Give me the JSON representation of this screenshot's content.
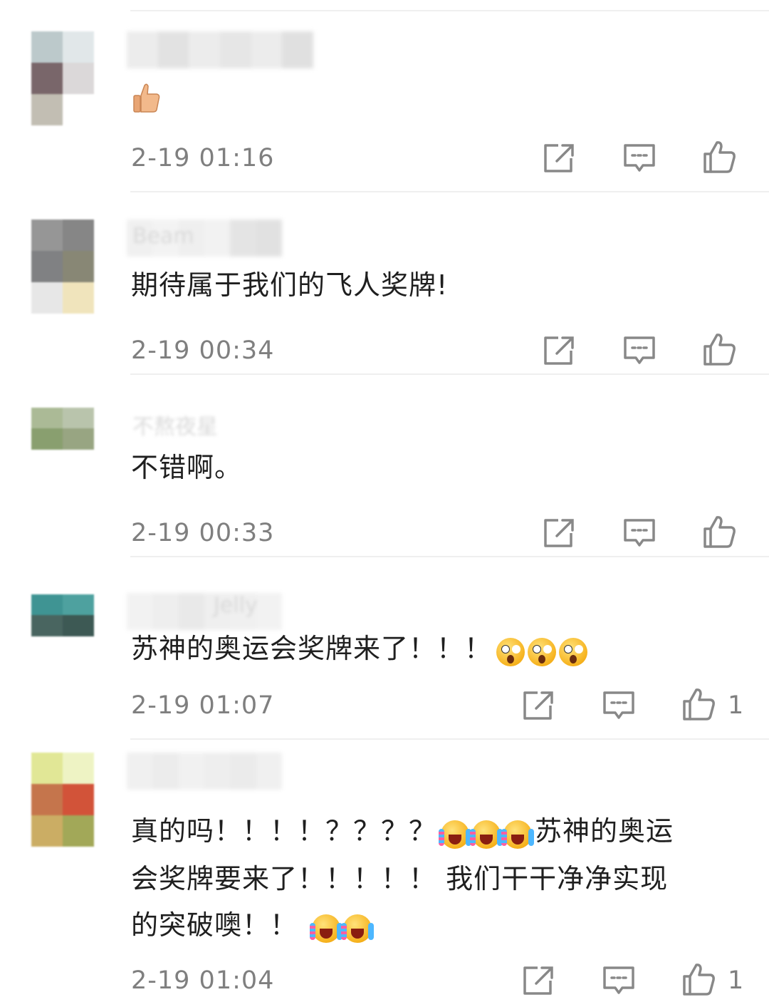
{
  "comments": [
    {
      "username": "",
      "content": "",
      "emoji_only": "thumbs-up-emoji",
      "time": "2-19 01:16",
      "likes": ""
    },
    {
      "username": "Beam",
      "content": "期待属于我们的飞人奖牌!",
      "time": "2-19 00:34",
      "likes": ""
    },
    {
      "username": "不熬夜星",
      "content": "不错啊。",
      "time": "2-19 00:33",
      "likes": ""
    },
    {
      "username": "Jelly",
      "content": "苏神的奥运会奖牌来了！！！",
      "emojis": [
        "shock-face-emoji",
        "shock-face-emoji",
        "shock-face-emoji"
      ],
      "time": "2-19 01:07",
      "likes": "1"
    },
    {
      "username": "",
      "content_line1": "真的吗！！！！？？？？",
      "content_line1b": "苏神的奥运",
      "content_line2": "会奖牌要来了！！！！！ 我们干干净净实现",
      "content_line3": "的突破噢！！",
      "emojis_a": [
        "crying-face-emoji",
        "crying-face-emoji",
        "crying-face-emoji"
      ],
      "emojis_b": [
        "crying-face-emoji",
        "crying-face-emoji"
      ],
      "time": "2-19 01:04",
      "likes": "1"
    }
  ],
  "icons": {
    "share": "share-edit-icon",
    "reply": "comment-icon",
    "like": "thumbs-up-icon"
  },
  "colors": {
    "text": "#1f1f1f",
    "meta": "#7f7f7f",
    "divider": "#efefef"
  }
}
